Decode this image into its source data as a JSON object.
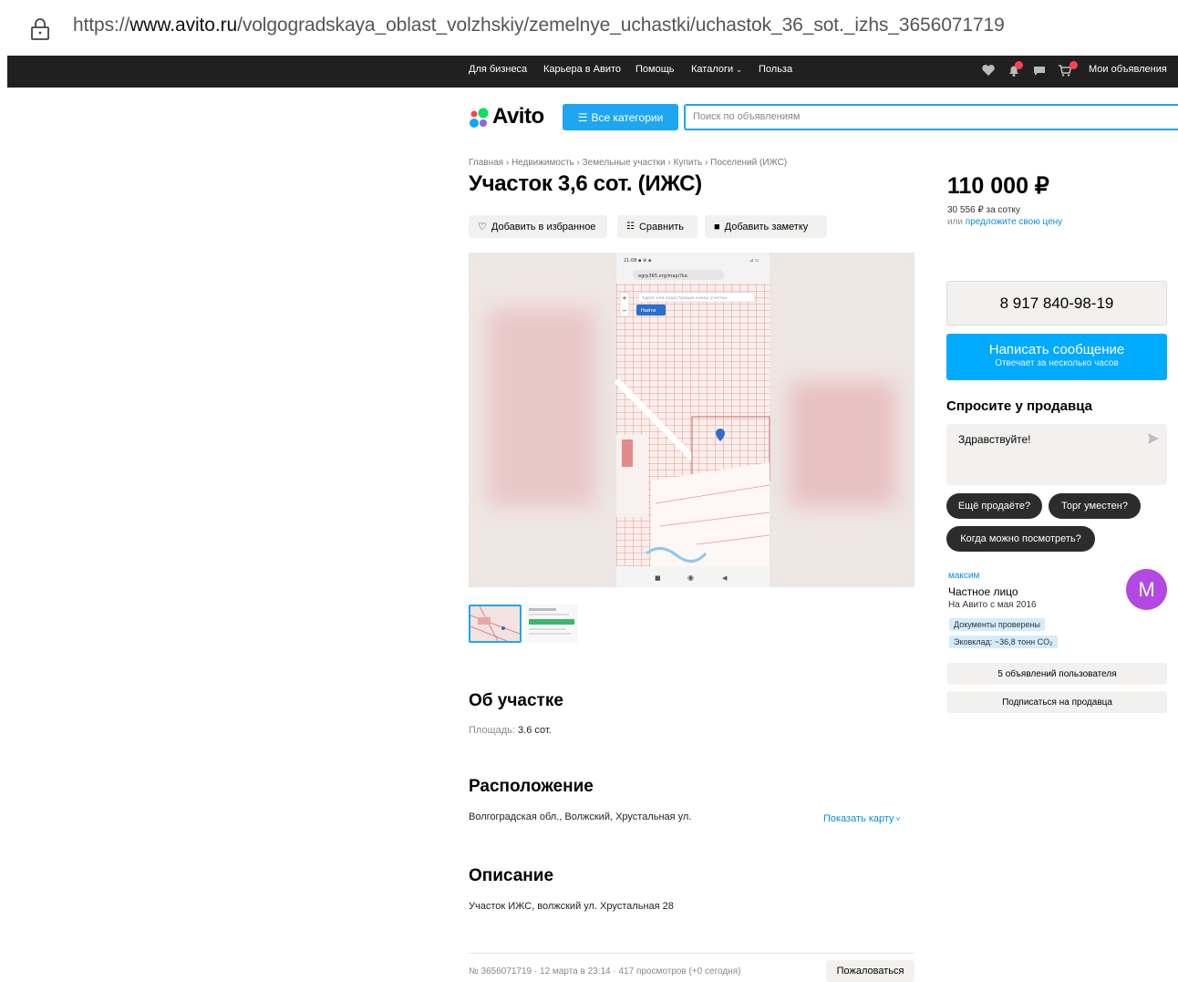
{
  "browser": {
    "url_prefix": "https://",
    "url_domain": "www.avito.ru",
    "url_path": "/volgogradskaya_oblast_volzhskiy/zemelnye_uchastki/uchastok_36_sot._izhs_3656071719"
  },
  "topnav": {
    "links": [
      "Для бизнеса",
      "Карьера в Авито",
      "Помощь",
      "Каталоги",
      "Польза"
    ],
    "my_ads": "Мои объявления"
  },
  "header": {
    "logo": "Avito",
    "all_categories": "Все категории",
    "search_placeholder": "Поиск по объявлениям"
  },
  "breadcrumb": "Главная › Недвижимость › Земельные участки › Купить › Поселений (ИЖС)",
  "listing": {
    "title": "Участок 3,6 сот. (ИЖС)",
    "actions": {
      "favorite": "Добавить в избранное",
      "compare": "Сравнить",
      "note": "Добавить заметку"
    },
    "about_title": "Об участке",
    "area_label": "Площадь:",
    "area_value": "3.6 сот.",
    "location_title": "Расположение",
    "location_text": "Волгоградская обл., Волжский, Хрустальная ул.",
    "show_map": "Показать карту",
    "description_title": "Описание",
    "description_text": "Участок ИЖС, волжский ул. Хрустальная 28",
    "meta": "№ 3656071719 · 12 марта в 23:14 · 417 просмотров (+0 сегодня)",
    "report": "Пожаловаться"
  },
  "screenshot_texts": {
    "search_hint": "Адрес или кадастровый номер участка",
    "find_button": "Найти"
  },
  "sidebar": {
    "price": "110 000 ₽",
    "price_per": "30 556 ₽ за сотку",
    "offer_prefix": "или",
    "offer_link": "предложите свою цену",
    "phone": "8 917 840-98-19",
    "message_btn": "Написать сообщение",
    "message_sub": "Отвечает за несколько часов",
    "ask_title": "Спросите у продавца",
    "ask_text": "Здравствуйте!",
    "quick": [
      "Ещё продаёте?",
      "Торг уместен?",
      "Когда можно посмотреть?"
    ],
    "seller_name": "максим",
    "seller_type": "Частное лицо",
    "seller_since": "На Авито с мая 2016",
    "avatar_letter": "М",
    "tag_docs": "Документы проверены",
    "tag_eco": "Эковклад: ~36,8 тонн CO₂",
    "user_ads": "5 объявлений пользователя",
    "subscribe": "Подписаться на продавца"
  },
  "colors": {
    "accent": "#00aaff",
    "nav_bg": "#202020",
    "avatar": "#b448e2",
    "link": "#0a8ed8"
  }
}
